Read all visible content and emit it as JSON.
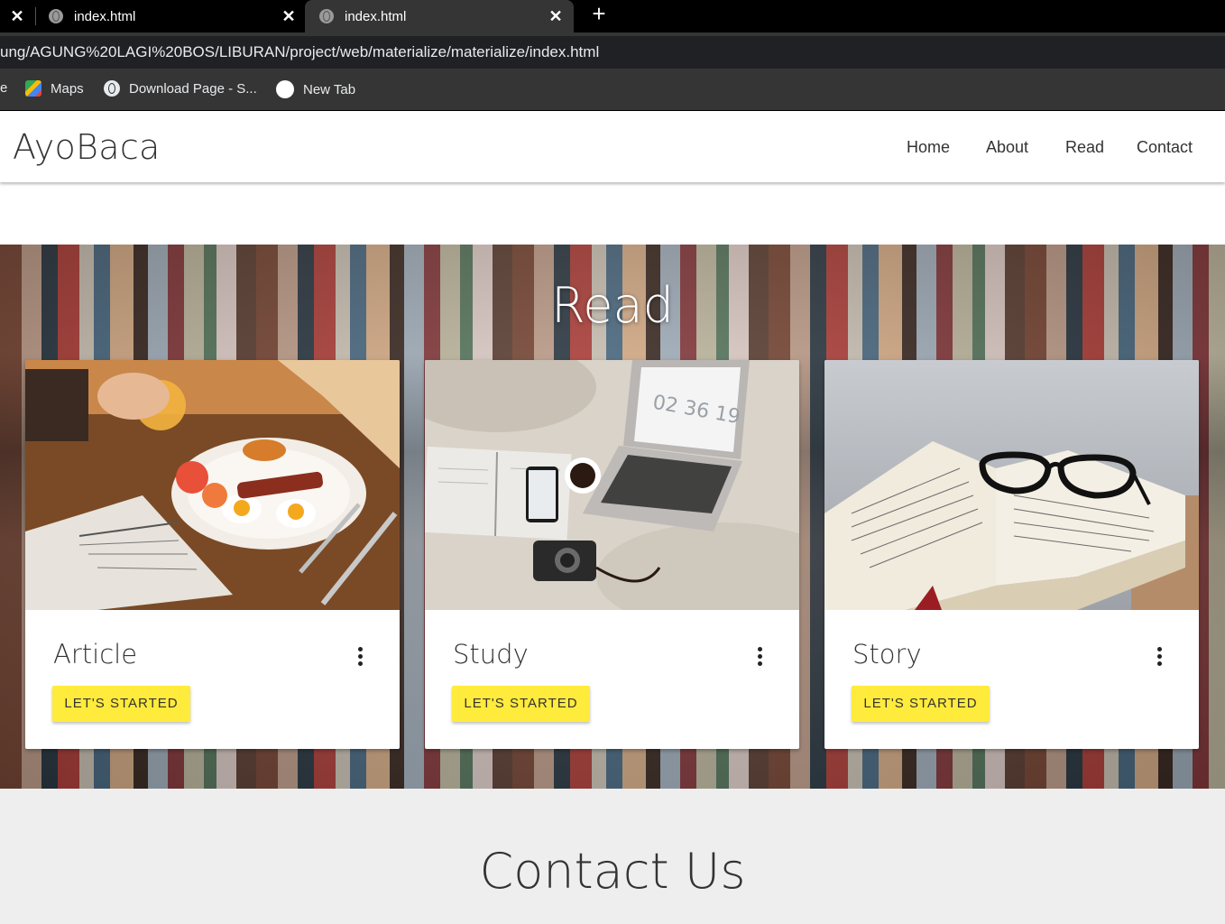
{
  "browser": {
    "tabs": [
      {
        "label": "index.html",
        "active": false
      },
      {
        "label": "index.html",
        "active": true
      }
    ],
    "url": "ung/AGUNG%20LAGI%20BOS/LIBURAN/project/web/materialize/materialize/index.html",
    "bookmarks": [
      "e",
      "Maps",
      "Download Page - S...",
      "New Tab"
    ]
  },
  "navbar": {
    "brand": "AyoBaca",
    "links": [
      "Home",
      "About",
      "Read",
      "Contact"
    ]
  },
  "read_section": {
    "title": "Read",
    "cards": [
      {
        "title": "Article",
        "button": "LET'S STARTED",
        "image": "breakfast-newspaper-photo"
      },
      {
        "title": "Study",
        "button": "LET'S STARTED",
        "image": "laptop-notebook-bed-photo"
      },
      {
        "title": "Story",
        "button": "LET'S STARTED",
        "image": "book-glasses-photo"
      }
    ]
  },
  "contact_section": {
    "title": "Contact Us"
  },
  "colors": {
    "button": "#ffeb3b",
    "navbar_bg": "#ffffff",
    "contact_bg": "#eeeeee",
    "browser_chrome": "#353535"
  }
}
